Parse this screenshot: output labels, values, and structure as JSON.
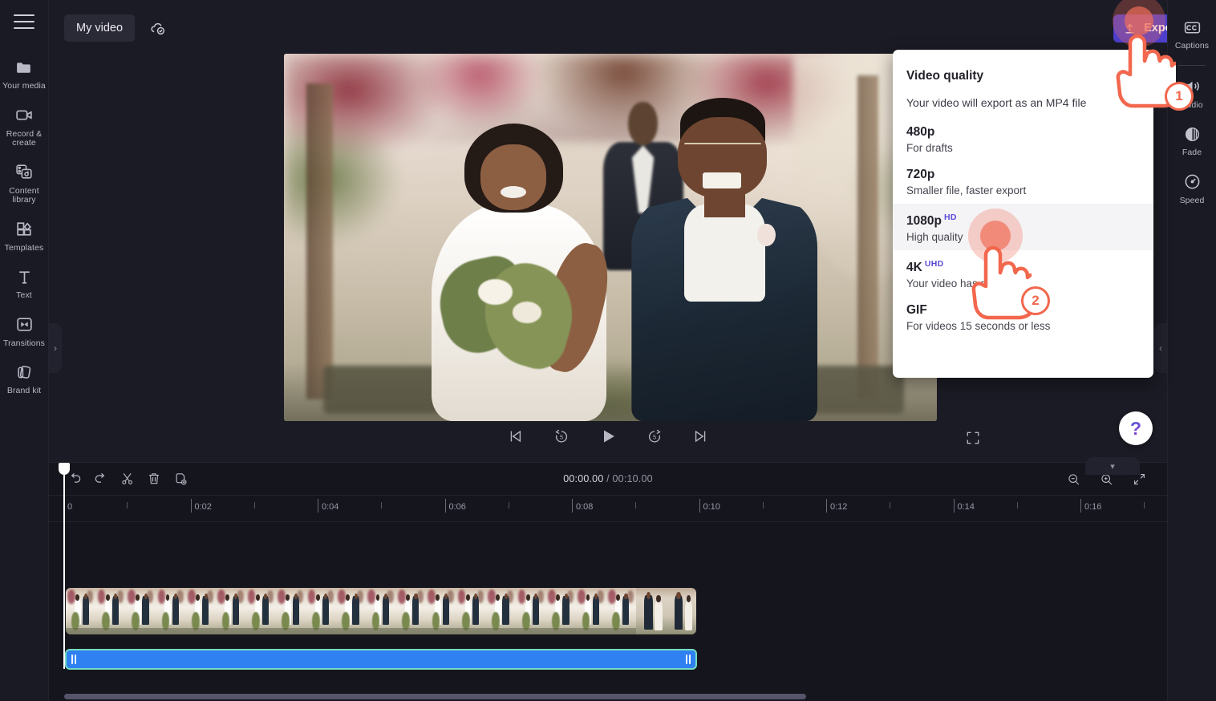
{
  "app": {
    "project_title": "My video",
    "cloud_status_icon": "cloud-saved-icon"
  },
  "left_sidebar": {
    "menu_icon": "hamburger-menu-icon",
    "items": [
      {
        "label": "Your media",
        "icon": "folder-icon"
      },
      {
        "label": "Record &\ncreate",
        "line1": "Record &",
        "line2": "create",
        "icon": "video-camera-icon"
      },
      {
        "label": "Content\nlibrary",
        "line1": "Content",
        "line2": "library",
        "icon": "media-library-icon"
      },
      {
        "label": "Templates",
        "icon": "templates-grid-icon"
      },
      {
        "label": "Text",
        "icon": "text-t-icon"
      },
      {
        "label": "Transitions",
        "icon": "transitions-icon"
      },
      {
        "label": "Brand kit",
        "icon": "brand-kit-icon"
      }
    ]
  },
  "toolbar": {
    "export_label": "Export",
    "export_icon": "upload-arrow-icon",
    "export_chevron_icon": "chevron-down-icon",
    "export_color": "#4d3fcb"
  },
  "right_sidebar": {
    "items": [
      {
        "label": "Captions",
        "icon": "cc-icon"
      },
      {
        "label": "Audio",
        "icon": "speaker-volume-icon"
      },
      {
        "label": "Fade",
        "icon": "fade-circle-icon"
      },
      {
        "label": "Speed",
        "icon": "speedometer-icon"
      }
    ]
  },
  "export_menu": {
    "title": "Video quality",
    "subtitle": "Your video will export as an MP4 file",
    "options": [
      {
        "name": "480p",
        "badge": "",
        "desc": "For drafts"
      },
      {
        "name": "720p",
        "badge": "",
        "desc": "Smaller file, faster export"
      },
      {
        "name": "1080p",
        "badge": "HD",
        "desc": "High quality",
        "highlighted": true
      },
      {
        "name": "4K",
        "badge": "UHD",
        "desc": "Your video has no 4K"
      },
      {
        "name": "GIF",
        "badge": "",
        "desc": "For videos 15 seconds or less"
      }
    ],
    "badge_color": "#5b4bdb"
  },
  "preview": {
    "controls": [
      {
        "icon": "skip-to-start-icon"
      },
      {
        "icon": "rewind-5-seconds-icon"
      },
      {
        "icon": "play-icon"
      },
      {
        "icon": "forward-5-seconds-icon"
      },
      {
        "icon": "skip-to-end-icon"
      }
    ],
    "fullscreen_icon": "fullscreen-icon",
    "left_panel_toggle_icon": "chevron-right-icon",
    "right_panel_toggle_icon": "chevron-left-icon",
    "help_label": "?",
    "collapse_icon": "chevron-down-icon"
  },
  "timeline": {
    "tools": [
      {
        "icon": "undo-icon"
      },
      {
        "icon": "redo-icon"
      },
      {
        "icon": "split-scissors-icon"
      },
      {
        "icon": "delete-trash-icon"
      },
      {
        "icon": "duplicate-icon"
      }
    ],
    "current_time": "00:00.00",
    "separator": " / ",
    "total_time": "00:10.00",
    "zoom_out_icon": "zoom-out-icon",
    "zoom_in_icon": "zoom-in-icon",
    "fit_icon": "fit-to-screen-icon",
    "ruler_labels": [
      "0",
      "0:02",
      "0:04",
      "0:06",
      "0:08",
      "0:10",
      "0:12",
      "0:14",
      "0:16"
    ],
    "video_track_name": "video-clip",
    "audio_track_name": "audio-clip",
    "audio_color": "#2f80f0",
    "selection_color": "#74dcc0"
  },
  "annotations": [
    {
      "step": "1",
      "target": "export-button"
    },
    {
      "step": "2",
      "target": "export-option-1080p"
    }
  ]
}
